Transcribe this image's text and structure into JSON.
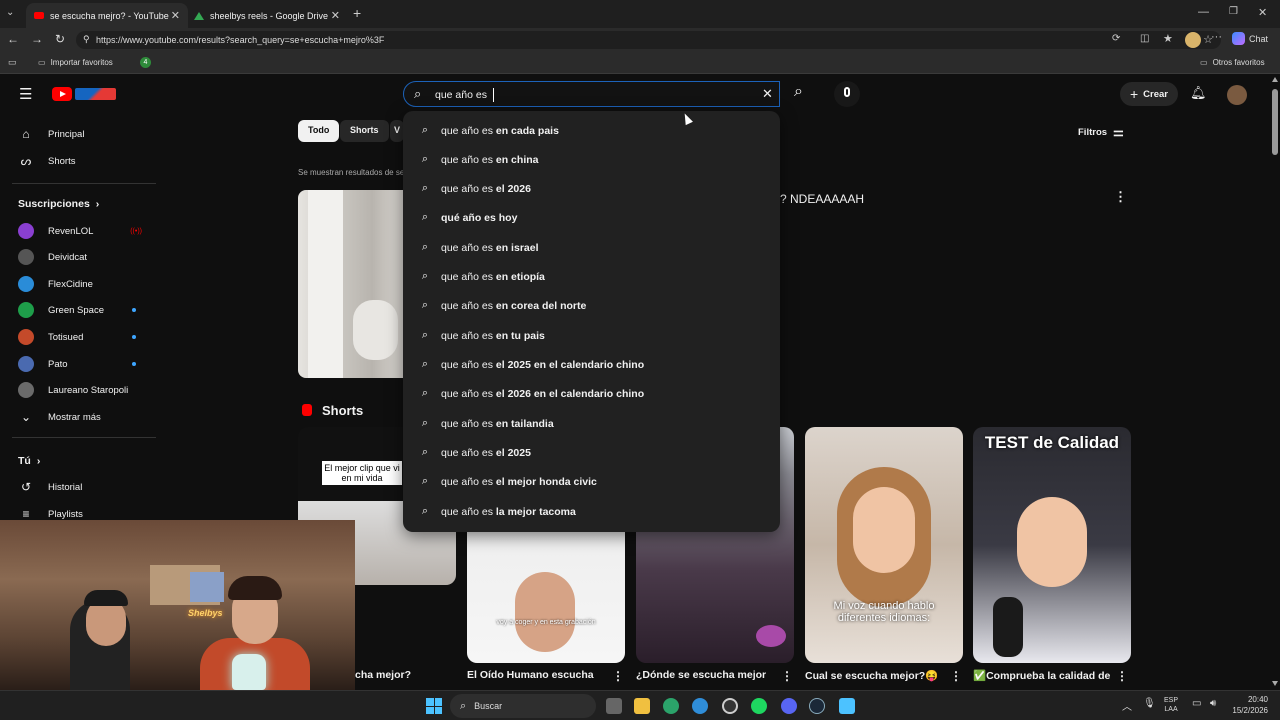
{
  "browser": {
    "tabs": [
      {
        "title": "se escucha mejro? - YouTube",
        "active": true
      },
      {
        "title": "sheelbys reels - Google Drive",
        "active": false
      }
    ],
    "url": "https://www.youtube.com/results?search_query=se+escucha+mejro%3F",
    "favorites": {
      "import_label": "Importar favoritos",
      "badge": "4",
      "other_label": "Otros favoritos"
    },
    "copilot_label": "Chat"
  },
  "youtube": {
    "search_value": "que año es ",
    "create_label": "Crear",
    "sidebar": {
      "main": [
        {
          "label": "Principal",
          "icon": "home-icon"
        },
        {
          "label": "Shorts",
          "icon": "shorts-icon"
        }
      ],
      "subscriptions_title": "Suscripciones",
      "subscriptions": [
        {
          "label": "RevenLOL",
          "color": "#8a3fd1",
          "indicator": "live"
        },
        {
          "label": "Deividcat",
          "color": "#555555",
          "indicator": ""
        },
        {
          "label": "FlexCidine",
          "color": "#2a8cd8",
          "indicator": ""
        },
        {
          "label": "Green Space",
          "color": "#1e9e4a",
          "indicator": "dot"
        },
        {
          "label": "Totisued",
          "color": "#c44a2a",
          "indicator": "dot"
        },
        {
          "label": "Pato",
          "color": "#4a6ab0",
          "indicator": "dot"
        },
        {
          "label": "Laureano Staropoli",
          "color": "#6a6a6a",
          "indicator": ""
        }
      ],
      "show_more": "Mostrar más",
      "you_title": "Tú",
      "you_items": [
        {
          "label": "Historial",
          "icon": "history-icon"
        },
        {
          "label": "Playlists",
          "icon": "playlists-icon"
        }
      ]
    },
    "chips": [
      "Todo",
      "Shorts",
      "V"
    ],
    "filters_label": "Filtros",
    "showing_results": "Se muestran resultados de se",
    "video_title_fragment": "? NDEAAAAAH",
    "suggestions": [
      {
        "prefix": "que año es ",
        "bold": "en cada pais"
      },
      {
        "prefix": "que año es ",
        "bold": "en china"
      },
      {
        "prefix": "que año es ",
        "bold": "el 2026"
      },
      {
        "prefix": "",
        "bold": "qué año es hoy"
      },
      {
        "prefix": "que año es ",
        "bold": "en israel"
      },
      {
        "prefix": "que año es ",
        "bold": "en etiopía"
      },
      {
        "prefix": "que año es ",
        "bold": "en corea del norte"
      },
      {
        "prefix": "que año es ",
        "bold": "en tu pais"
      },
      {
        "prefix": "que año es ",
        "bold": "el 2025 en el calendario chino"
      },
      {
        "prefix": "que año es ",
        "bold": "el 2026 en el calendario chino"
      },
      {
        "prefix": "que año es ",
        "bold": "en tailandia"
      },
      {
        "prefix": "que año es ",
        "bold": "el 2025"
      },
      {
        "prefix": "que año es ",
        "bold": "el mejor honda civic"
      },
      {
        "prefix": "que año es ",
        "bold": "la mejor tacoma"
      }
    ],
    "shorts_title": "Shorts",
    "shorts": [
      {
        "title": "cha mejor?",
        "caption": "El mejor clip que vi en mi vida"
      },
      {
        "title": "El Oído Humano escucha",
        "caption": "voy a coger y en esta grabación"
      },
      {
        "title": "¿Dónde se escucha mejor",
        "caption": ""
      },
      {
        "title": "Cual se escucha mejor?😝",
        "caption": "Mi voz cuando hablo diferentes idiomas:"
      },
      {
        "title": "✅Comprueba la calidad de",
        "caption": "TEST de Calidad"
      }
    ]
  },
  "taskbar": {
    "search_label": "Buscar",
    "lang": "ESP",
    "lang2": "LAA",
    "time": "20:40",
    "date": "15/2/2026"
  },
  "webcam": {
    "sign_text": "Shelbys"
  }
}
